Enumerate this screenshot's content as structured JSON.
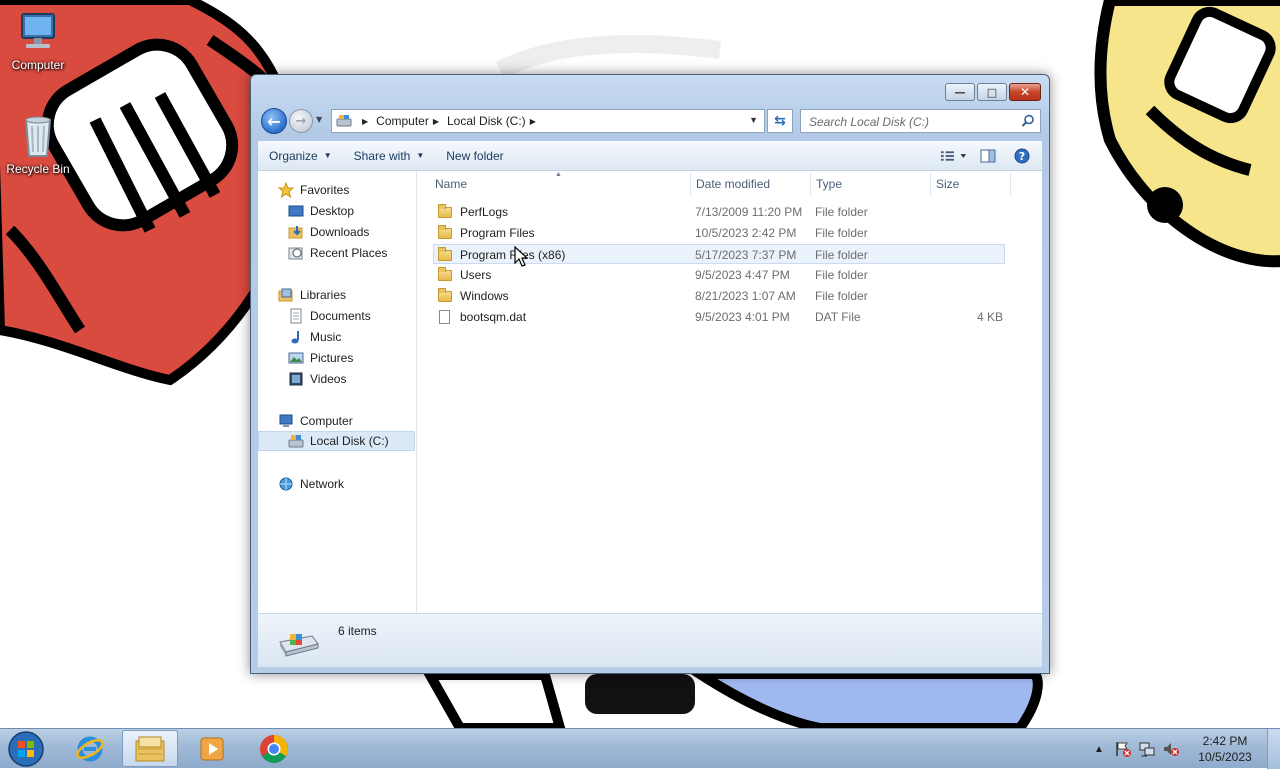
{
  "desktop": {
    "icons": [
      {
        "label": "Computer",
        "icon": "computer-icon"
      },
      {
        "label": "Recycle Bin",
        "icon": "recycle-bin-icon"
      }
    ]
  },
  "window": {
    "caption_buttons": {
      "minimize": "minimize",
      "maximize": "maximize",
      "close": "close"
    },
    "breadcrumb": [
      "Computer",
      "Local Disk (C:)"
    ],
    "search_placeholder": "Search Local Disk (C:)",
    "commands": {
      "organize": "Organize",
      "share_with": "Share with",
      "new_folder": "New folder"
    },
    "nav_pane": {
      "favorites": {
        "label": "Favorites",
        "items": [
          "Desktop",
          "Downloads",
          "Recent Places"
        ]
      },
      "libraries": {
        "label": "Libraries",
        "items": [
          "Documents",
          "Music",
          "Pictures",
          "Videos"
        ]
      },
      "computer": {
        "label": "Computer",
        "items": [
          "Local Disk (C:)"
        ],
        "selected": "Local Disk (C:)"
      },
      "network": {
        "label": "Network"
      }
    },
    "columns": {
      "name": "Name",
      "date": "Date modified",
      "type": "Type",
      "size": "Size"
    },
    "files": [
      {
        "name": "PerfLogs",
        "date": "7/13/2009 11:20 PM",
        "type": "File folder",
        "size": "",
        "kind": "folder"
      },
      {
        "name": "Program Files",
        "date": "10/5/2023 2:42 PM",
        "type": "File folder",
        "size": "",
        "kind": "folder"
      },
      {
        "name": "Program Files (x86)",
        "date": "5/17/2023 7:37 PM",
        "type": "File folder",
        "size": "",
        "kind": "folder",
        "hovered": true
      },
      {
        "name": "Users",
        "date": "9/5/2023 4:47 PM",
        "type": "File folder",
        "size": "",
        "kind": "folder"
      },
      {
        "name": "Windows",
        "date": "8/21/2023 1:07 AM",
        "type": "File folder",
        "size": "",
        "kind": "folder"
      },
      {
        "name": "bootsqm.dat",
        "date": "9/5/2023 4:01 PM",
        "type": "DAT File",
        "size": "4 KB",
        "kind": "file"
      }
    ],
    "status": {
      "item_count": "6 items"
    }
  },
  "taskbar": {
    "pinned": [
      "start-orb-icon",
      "internet-explorer-icon",
      "windows-explorer-icon",
      "media-player-icon",
      "chrome-icon"
    ],
    "active": "windows-explorer-icon",
    "clock": {
      "time": "2:42 PM",
      "date": "10/5/2023"
    }
  },
  "colors": {
    "accent": "#2c6fcb",
    "selection": "#dbe8f6",
    "wallpaper_red": "#d94a3f",
    "wallpaper_yellow": "#f6e58a",
    "wallpaper_blue": "#9fb8ef"
  }
}
